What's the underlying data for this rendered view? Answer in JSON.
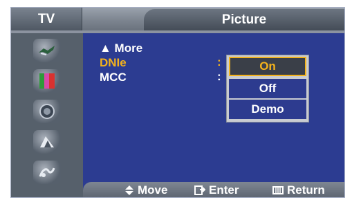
{
  "header": {
    "source": "TV",
    "title": "Picture"
  },
  "sidebar": {
    "icons": [
      {
        "name": "input-icon"
      },
      {
        "name": "picture-icon"
      },
      {
        "name": "sound-icon"
      },
      {
        "name": "channel-icon"
      },
      {
        "name": "setup-icon"
      }
    ]
  },
  "menu": {
    "items": [
      {
        "label": "▲ More"
      },
      {
        "label": "DNIe",
        "value_sep": ":"
      },
      {
        "label": "MCC",
        "value_sep": ":"
      }
    ]
  },
  "dropdown": {
    "options": [
      {
        "label": "On",
        "selected": true
      },
      {
        "label": "Off"
      },
      {
        "label": "Demo"
      }
    ]
  },
  "footer": {
    "move": "Move",
    "enter": "Enter",
    "return": "Return"
  },
  "colors": {
    "accent": "#f3b21c",
    "background": "#2c3c91"
  }
}
